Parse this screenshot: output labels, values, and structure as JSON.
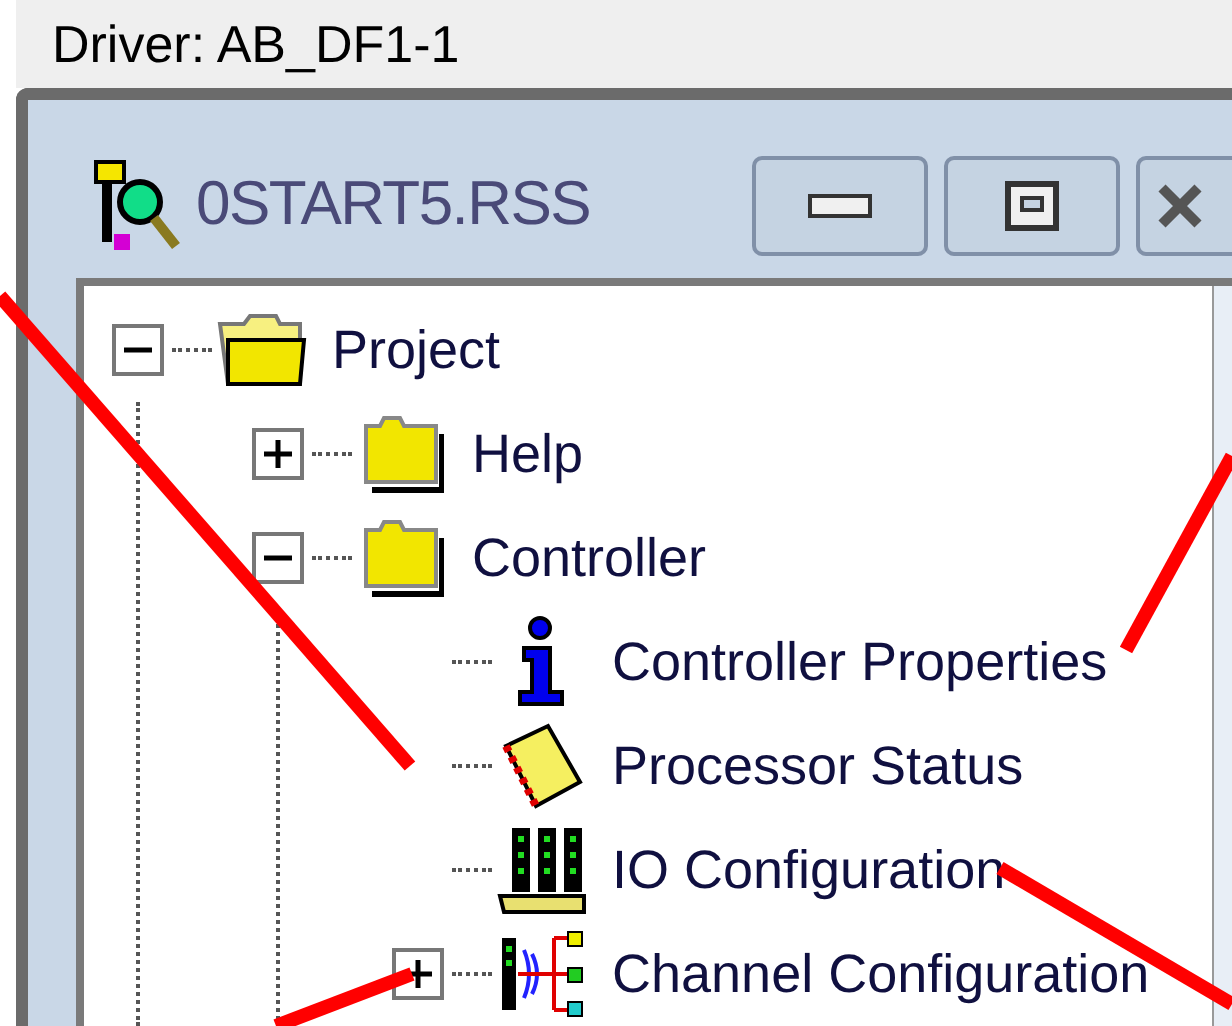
{
  "driver_label": "Driver: AB_DF1-1",
  "window": {
    "title": "0START5.RSS",
    "buttons": [
      {
        "kind": "minimize"
      },
      {
        "kind": "maximize"
      },
      {
        "kind": "close"
      }
    ]
  },
  "tree": [
    {
      "label": "Project",
      "kind": "open-folder",
      "expanded": true,
      "children": [
        {
          "label": "Help",
          "kind": "folder",
          "expanded": false
        },
        {
          "label": "Controller",
          "kind": "folder",
          "expanded": true,
          "children": [
            {
              "label": "Controller Properties",
              "kind": "info"
            },
            {
              "label": "Processor Status",
              "kind": "status"
            },
            {
              "label": "IO Configuration",
              "kind": "io"
            },
            {
              "label": "Channel Configuration",
              "kind": "channel",
              "expanded": false
            }
          ]
        }
      ]
    }
  ]
}
